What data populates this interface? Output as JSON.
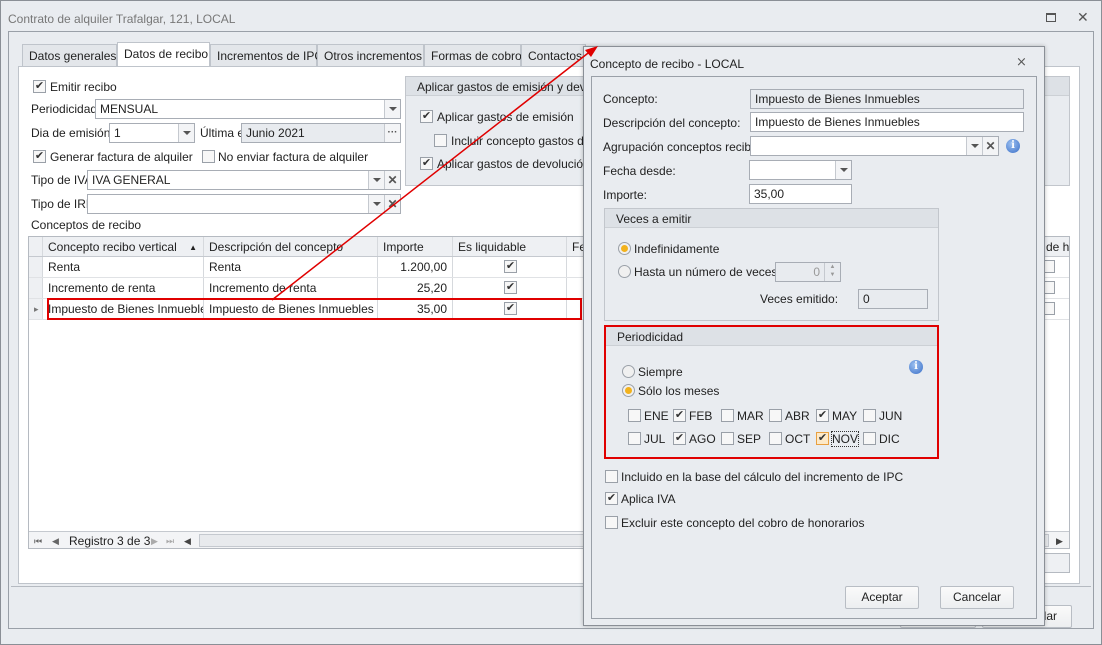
{
  "window": {
    "title": "Contrato de alquiler Trafalgar, 121, LOCAL",
    "restore_icon": "restore-icon",
    "close_icon": "close-icon"
  },
  "tabs": [
    {
      "label": "Datos generales"
    },
    {
      "label": "Datos de recibo",
      "active": true
    },
    {
      "label": "Incrementos de IPC"
    },
    {
      "label": "Otros incrementos"
    },
    {
      "label": "Formas de cobro"
    },
    {
      "label": "Contactos"
    }
  ],
  "recibo": {
    "emitir_label": "Emitir recibo",
    "emitir_checked": true,
    "periodicidad_label": "Periodicidad:",
    "periodicidad_value": "MENSUAL",
    "dia_label": "Dia de emisión:",
    "dia_value": "1",
    "ultima_label": "Última emisión:",
    "ultima_value": "Junio 2021",
    "ellipsis": "···",
    "generar_label": "Generar factura de alquiler",
    "generar_checked": true,
    "no_enviar_label": "No enviar factura de alquiler",
    "no_enviar_checked": false,
    "iva_label": "Tipo de IVA:",
    "iva_value": "IVA GENERAL",
    "irpf_label": "Tipo de IRPF:",
    "irpf_value": "",
    "conceptos_label": "Conceptos de recibo",
    "gastos": {
      "title": "Aplicar gastos de emisión y devolución",
      "emision_label": "Aplicar gastos de emisión",
      "emision_checked": true,
      "incluir_label": "Incluir concepto gastos de emisión",
      "incluir_checked": false,
      "devolucion_label": "Aplicar gastos de devolución",
      "devolucion_checked": true
    }
  },
  "grid": {
    "columns": [
      "Concepto recibo vertical",
      "Descripción del concepto",
      "Importe",
      "Es liquidable",
      "Fe",
      "de ho"
    ],
    "rows": [
      {
        "concepto": "Renta",
        "descripcion": "Renta",
        "importe": "1.200,00",
        "liquidable": true
      },
      {
        "concepto": "Incremento de renta",
        "descripcion": "Incremento de renta",
        "importe": "25,20",
        "liquidable": true
      },
      {
        "concepto": "Impuesto de Bienes Inmuebles",
        "descripcion": "Impuesto de Bienes Inmuebles",
        "importe": "35,00",
        "liquidable": true,
        "selected": true
      }
    ],
    "navigator": "Registro 3 de 3"
  },
  "main_buttons": {
    "cancel_partial": "lar"
  },
  "dialog": {
    "title": "Concepto de recibo - LOCAL",
    "concepto_label": "Concepto:",
    "concepto_value": "Impuesto de Bienes Inmuebles",
    "descripcion_label": "Descripción del concepto:",
    "descripcion_value": "Impuesto de Bienes Inmuebles",
    "agrupacion_label": "Agrupación conceptos recibo:",
    "agrupacion_value": "",
    "fecha_label": "Fecha desde:",
    "fecha_value": "",
    "importe_label": "Importe:",
    "importe_value": "35,00",
    "veces": {
      "title": "Veces a emitir",
      "indef_label": "Indefinidamente",
      "hasta_label": "Hasta un número de veces",
      "hasta_value": "0",
      "selected": "indefinidamente",
      "emitido_label": "Veces emitido:",
      "emitido_value": "0"
    },
    "periodicidad": {
      "title": "Periodicidad",
      "siempre_label": "Siempre",
      "solo_label": "Sólo los meses",
      "selected": "solo",
      "months": [
        {
          "label": "ENE",
          "checked": false
        },
        {
          "label": "FEB",
          "checked": true
        },
        {
          "label": "MAR",
          "checked": false
        },
        {
          "label": "ABR",
          "checked": false
        },
        {
          "label": "MAY",
          "checked": true
        },
        {
          "label": "JUN",
          "checked": false
        },
        {
          "label": "JUL",
          "checked": false
        },
        {
          "label": "AGO",
          "checked": true
        },
        {
          "label": "SEP",
          "checked": false
        },
        {
          "label": "OCT",
          "checked": false
        },
        {
          "label": "NOV",
          "checked": true,
          "focused": true
        },
        {
          "label": "DIC",
          "checked": false
        }
      ]
    },
    "incluido_label": "Incluido en la base del cálculo del incremento de IPC",
    "incluido_checked": false,
    "aplica_iva_label": "Aplica IVA",
    "aplica_iva_checked": true,
    "excluir_label": "Excluir este concepto del cobro de honorarios",
    "excluir_checked": false,
    "aceptar": "Aceptar",
    "cancelar": "Cancelar"
  },
  "colors": {
    "highlight": "#e00000",
    "radio_selected": "#f2b21c",
    "panel": "#e9ecf0"
  }
}
